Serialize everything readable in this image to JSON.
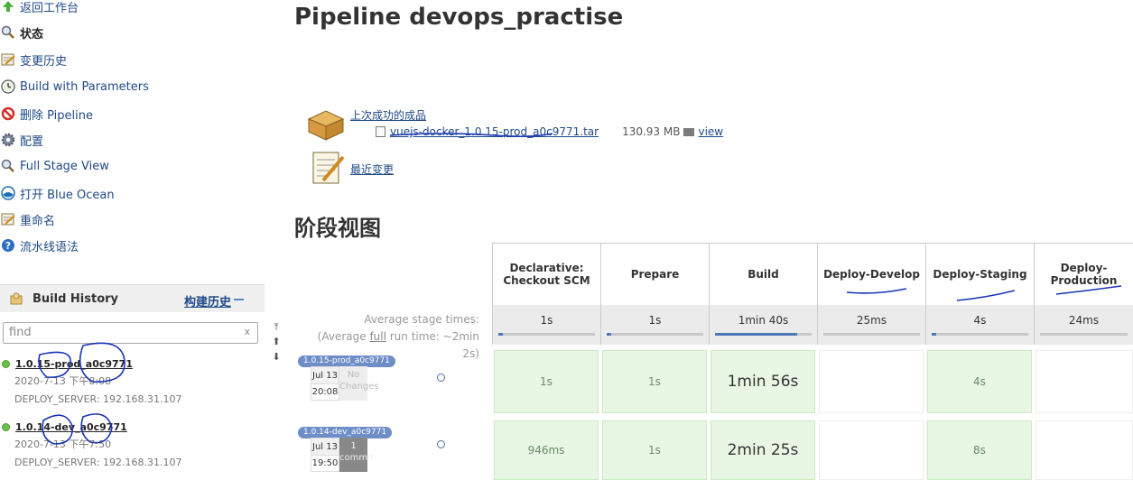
{
  "sidebar": {
    "tasks": [
      {
        "label": "返回工作台",
        "icon": "up-arrow-icon"
      },
      {
        "label": "状态",
        "icon": "magnifier-icon"
      },
      {
        "label": "变更历史",
        "icon": "notepad-icon"
      },
      {
        "label": "Build with Parameters",
        "icon": "clock-icon"
      },
      {
        "label": "删除 Pipeline",
        "icon": "no-entry-icon"
      },
      {
        "label": "配置",
        "icon": "gear-icon"
      },
      {
        "label": "Full Stage View",
        "icon": "magnifier-icon"
      },
      {
        "label": "打开 Blue Ocean",
        "icon": "blue-ocean-icon"
      },
      {
        "label": "重命名",
        "icon": "notepad-icon"
      },
      {
        "label": "流水线语法",
        "icon": "help-icon"
      }
    ]
  },
  "build_history": {
    "title": "Build History",
    "trend_label": "构建历史",
    "find_placeholder": "find",
    "clear_label": "x",
    "builds": [
      {
        "name": "1.0.15-prod_a0c9771",
        "time": "2020-7-13 下午8:08",
        "param": "DEPLOY_SERVER: 192.168.31.107"
      },
      {
        "name": "1.0.14-dev_a0c9771",
        "time": "2020-7-13 下午7:50",
        "param": "DEPLOY_SERVER: 192.168.31.107"
      }
    ]
  },
  "main": {
    "title": "Pipeline devops_practise",
    "last_artifacts_label": "上次成功的成品",
    "artifact": {
      "name": "vuejs-docker_1.0.15-prod_a0c9771.tar",
      "size": "130.93 MB",
      "view_label": "view"
    },
    "recent_changes_label": "最近变更",
    "stage_view_title": "阶段视图"
  },
  "stage_view": {
    "stages": [
      {
        "name": "Declarative: Checkout SCM",
        "avg": "1s",
        "avg_fill": 0.05
      },
      {
        "name": "Prepare",
        "avg": "1s",
        "avg_fill": 0.05
      },
      {
        "name": "Build",
        "avg": "1min 40s",
        "avg_fill": 0.85
      },
      {
        "name": "Deploy-Develop",
        "avg": "25ms",
        "avg_fill": 0.0
      },
      {
        "name": "Deploy-Staging",
        "avg": "4s",
        "avg_fill": 0.05
      },
      {
        "name": "Deploy-Production",
        "avg": "24ms",
        "avg_fill": 0.0
      }
    ],
    "avg_label_1": "Average stage times:",
    "avg_label_2a": "(Average ",
    "avg_label_2b": "full",
    "avg_label_2c": " run time: ~2min",
    "avg_label_3": "2s)",
    "runs": [
      {
        "badge": "1.0.15-prod_a0c9771",
        "date": "Jul 13",
        "time": "20:08",
        "changes_1": "No",
        "changes_2": "Changes",
        "cells": [
          "1s",
          "1s",
          "1min 56s",
          "",
          "4s",
          ""
        ]
      },
      {
        "badge": "1.0.14-dev_a0c9771",
        "date": "Jul 13",
        "time": "19:50",
        "changes_1": "1",
        "changes_2": "commit",
        "cells": [
          "946ms",
          "1s",
          "2min 25s",
          "",
          "8s",
          ""
        ]
      }
    ]
  }
}
